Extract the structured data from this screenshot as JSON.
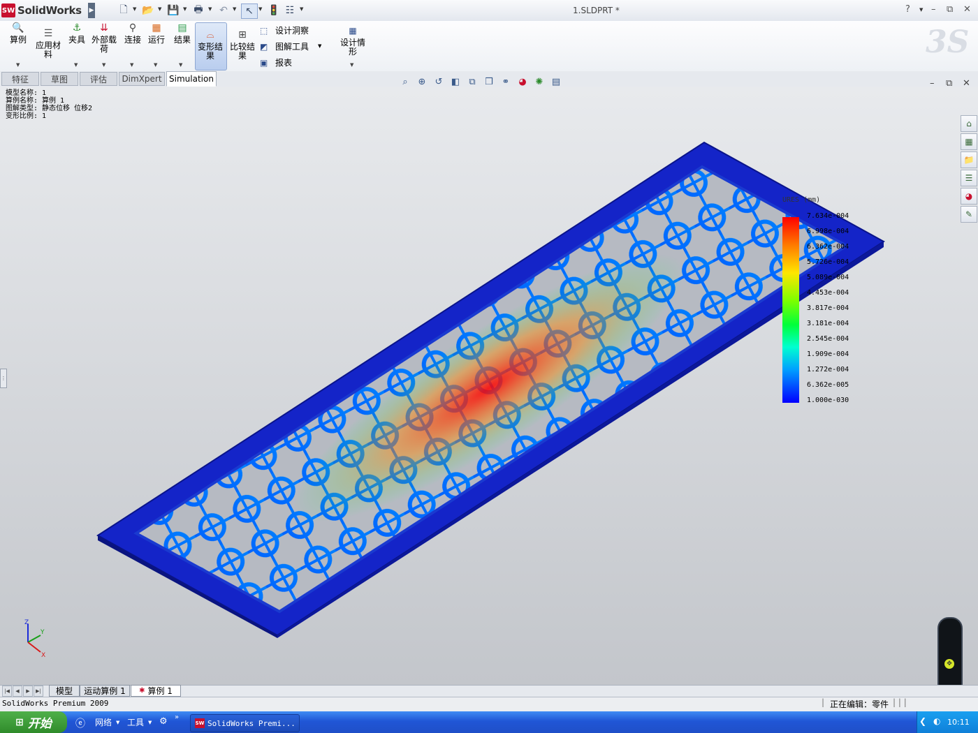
{
  "app": {
    "name": "SolidWorks",
    "logo_text": "SW",
    "document_title": "1.SLDPRT *"
  },
  "window_controls": {
    "help": "?",
    "minimize": "–",
    "restore": "⧉",
    "close": "✕"
  },
  "ribbon": {
    "study": "算例",
    "apply_material": "应用材料",
    "fixtures": "夹具",
    "external_loads": "外部载荷",
    "connections": "连接",
    "run": "运行",
    "results": "结果",
    "deformed_result": "变形结果",
    "compare_results": "比较结果",
    "design_insight": "设计洞察",
    "plot_tools": "图解工具",
    "report": "报表",
    "design_scenario": "设计情形"
  },
  "command_tabs": [
    "特征",
    "草图",
    "评估",
    "DimXpert",
    "Simulation"
  ],
  "active_command_tab": "Simulation",
  "plot_info": [
    "模型名称: 1",
    "算例名称: 算例 1",
    "图解类型: 静态位移 位移2",
    "变形比例: 1"
  ],
  "legend": {
    "title": "URES (mm)",
    "labels": [
      "7.634e-004",
      "6.998e-004",
      "6.362e-004",
      "5.726e-004",
      "5.089e-004",
      "4.453e-004",
      "3.817e-004",
      "3.181e-004",
      "2.545e-004",
      "1.909e-004",
      "1.272e-004",
      "6.362e-005",
      "1.000e-030"
    ]
  },
  "triad": {
    "x": "X",
    "y": "Y",
    "z": "Z"
  },
  "bottom_tabs": [
    "模型",
    "运动算例 1",
    "算例 1"
  ],
  "active_bottom_tab": "算例 1",
  "status": {
    "left": "SolidWorks Premium 2009",
    "right": "正在编辑：零件"
  },
  "taskbar": {
    "start": "开始",
    "network": "网络",
    "tools": "工具",
    "app_button": "SolidWorks Premi...",
    "clock": "10:11"
  }
}
